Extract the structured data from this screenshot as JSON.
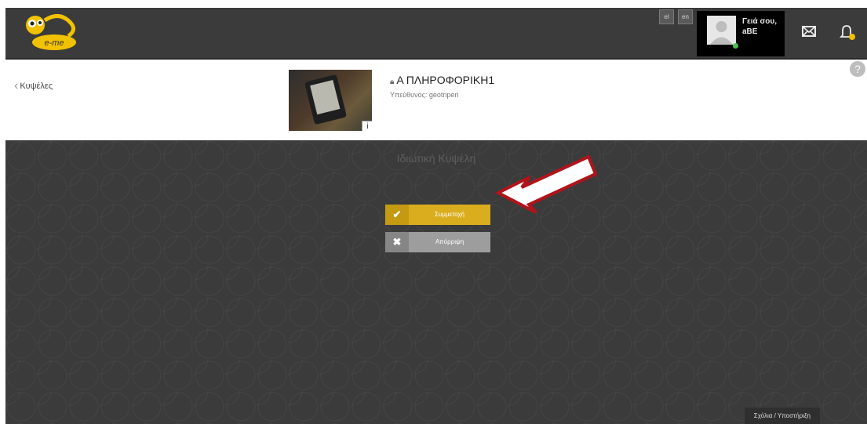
{
  "topbar": {
    "lang_el": "el",
    "lang_en": "en",
    "greeting_line1": "Γειά σου,",
    "greeting_line2": "aBE",
    "mail_icon": "envelope-icon",
    "bell_icon": "bell-icon",
    "logo_text": "e-me"
  },
  "header": {
    "back_label": "Κυψέλες",
    "course_title": "Α ΠΛΗΡΟΦΟΡΙΚΗ1",
    "owner_line": "Υπεύθυνος: geotriperi",
    "info_label": "i",
    "help_label": "?"
  },
  "main": {
    "private_label": "Ιδιωτική Κυψέλη",
    "join_label": "Συμμετοχή",
    "reject_label": "Απόρριψη",
    "support_label": "Σχόλια / Υποστήριξη"
  },
  "colors": {
    "accent_yellow": "#d9ad1d",
    "arrow_red": "#b0141a",
    "dark_bg": "#3b3b3b"
  }
}
